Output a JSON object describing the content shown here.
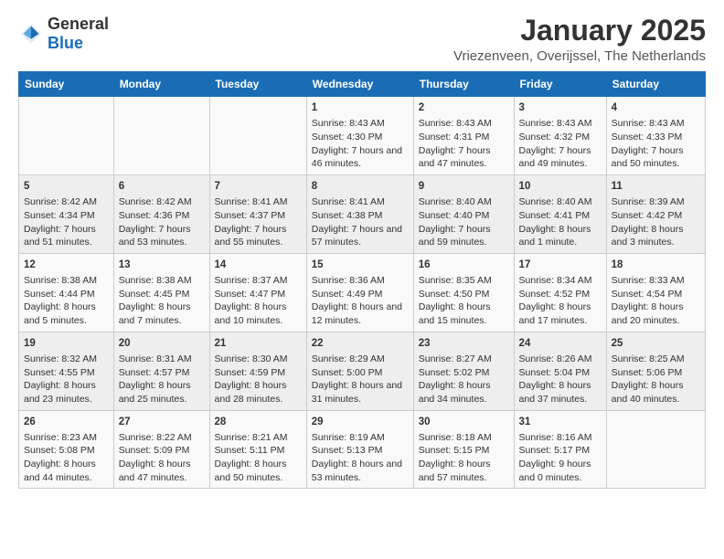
{
  "logo": {
    "general": "General",
    "blue": "Blue"
  },
  "title": "January 2025",
  "subtitle": "Vriezenveen, Overijssel, The Netherlands",
  "weekdays": [
    "Sunday",
    "Monday",
    "Tuesday",
    "Wednesday",
    "Thursday",
    "Friday",
    "Saturday"
  ],
  "weeks": [
    [
      {
        "day": "",
        "content": ""
      },
      {
        "day": "",
        "content": ""
      },
      {
        "day": "",
        "content": ""
      },
      {
        "day": "1",
        "content": "Sunrise: 8:43 AM\nSunset: 4:30 PM\nDaylight: 7 hours and 46 minutes."
      },
      {
        "day": "2",
        "content": "Sunrise: 8:43 AM\nSunset: 4:31 PM\nDaylight: 7 hours and 47 minutes."
      },
      {
        "day": "3",
        "content": "Sunrise: 8:43 AM\nSunset: 4:32 PM\nDaylight: 7 hours and 49 minutes."
      },
      {
        "day": "4",
        "content": "Sunrise: 8:43 AM\nSunset: 4:33 PM\nDaylight: 7 hours and 50 minutes."
      }
    ],
    [
      {
        "day": "5",
        "content": "Sunrise: 8:42 AM\nSunset: 4:34 PM\nDaylight: 7 hours and 51 minutes."
      },
      {
        "day": "6",
        "content": "Sunrise: 8:42 AM\nSunset: 4:36 PM\nDaylight: 7 hours and 53 minutes."
      },
      {
        "day": "7",
        "content": "Sunrise: 8:41 AM\nSunset: 4:37 PM\nDaylight: 7 hours and 55 minutes."
      },
      {
        "day": "8",
        "content": "Sunrise: 8:41 AM\nSunset: 4:38 PM\nDaylight: 7 hours and 57 minutes."
      },
      {
        "day": "9",
        "content": "Sunrise: 8:40 AM\nSunset: 4:40 PM\nDaylight: 7 hours and 59 minutes."
      },
      {
        "day": "10",
        "content": "Sunrise: 8:40 AM\nSunset: 4:41 PM\nDaylight: 8 hours and 1 minute."
      },
      {
        "day": "11",
        "content": "Sunrise: 8:39 AM\nSunset: 4:42 PM\nDaylight: 8 hours and 3 minutes."
      }
    ],
    [
      {
        "day": "12",
        "content": "Sunrise: 8:38 AM\nSunset: 4:44 PM\nDaylight: 8 hours and 5 minutes."
      },
      {
        "day": "13",
        "content": "Sunrise: 8:38 AM\nSunset: 4:45 PM\nDaylight: 8 hours and 7 minutes."
      },
      {
        "day": "14",
        "content": "Sunrise: 8:37 AM\nSunset: 4:47 PM\nDaylight: 8 hours and 10 minutes."
      },
      {
        "day": "15",
        "content": "Sunrise: 8:36 AM\nSunset: 4:49 PM\nDaylight: 8 hours and 12 minutes."
      },
      {
        "day": "16",
        "content": "Sunrise: 8:35 AM\nSunset: 4:50 PM\nDaylight: 8 hours and 15 minutes."
      },
      {
        "day": "17",
        "content": "Sunrise: 8:34 AM\nSunset: 4:52 PM\nDaylight: 8 hours and 17 minutes."
      },
      {
        "day": "18",
        "content": "Sunrise: 8:33 AM\nSunset: 4:54 PM\nDaylight: 8 hours and 20 minutes."
      }
    ],
    [
      {
        "day": "19",
        "content": "Sunrise: 8:32 AM\nSunset: 4:55 PM\nDaylight: 8 hours and 23 minutes."
      },
      {
        "day": "20",
        "content": "Sunrise: 8:31 AM\nSunset: 4:57 PM\nDaylight: 8 hours and 25 minutes."
      },
      {
        "day": "21",
        "content": "Sunrise: 8:30 AM\nSunset: 4:59 PM\nDaylight: 8 hours and 28 minutes."
      },
      {
        "day": "22",
        "content": "Sunrise: 8:29 AM\nSunset: 5:00 PM\nDaylight: 8 hours and 31 minutes."
      },
      {
        "day": "23",
        "content": "Sunrise: 8:27 AM\nSunset: 5:02 PM\nDaylight: 8 hours and 34 minutes."
      },
      {
        "day": "24",
        "content": "Sunrise: 8:26 AM\nSunset: 5:04 PM\nDaylight: 8 hours and 37 minutes."
      },
      {
        "day": "25",
        "content": "Sunrise: 8:25 AM\nSunset: 5:06 PM\nDaylight: 8 hours and 40 minutes."
      }
    ],
    [
      {
        "day": "26",
        "content": "Sunrise: 8:23 AM\nSunset: 5:08 PM\nDaylight: 8 hours and 44 minutes."
      },
      {
        "day": "27",
        "content": "Sunrise: 8:22 AM\nSunset: 5:09 PM\nDaylight: 8 hours and 47 minutes."
      },
      {
        "day": "28",
        "content": "Sunrise: 8:21 AM\nSunset: 5:11 PM\nDaylight: 8 hours and 50 minutes."
      },
      {
        "day": "29",
        "content": "Sunrise: 8:19 AM\nSunset: 5:13 PM\nDaylight: 8 hours and 53 minutes."
      },
      {
        "day": "30",
        "content": "Sunrise: 8:18 AM\nSunset: 5:15 PM\nDaylight: 8 hours and 57 minutes."
      },
      {
        "day": "31",
        "content": "Sunrise: 8:16 AM\nSunset: 5:17 PM\nDaylight: 9 hours and 0 minutes."
      },
      {
        "day": "",
        "content": ""
      }
    ]
  ]
}
